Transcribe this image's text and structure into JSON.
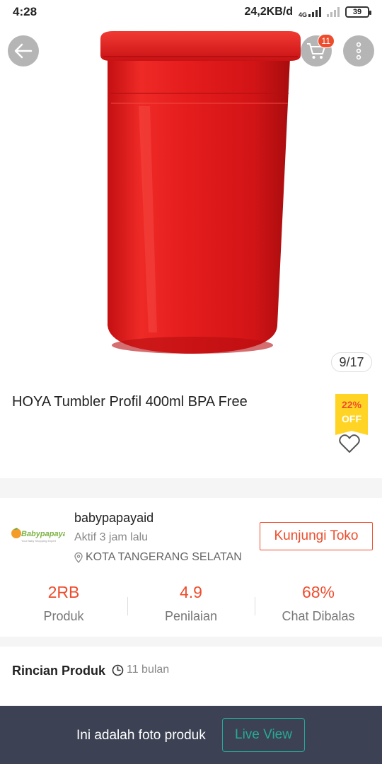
{
  "status_bar": {
    "time": "4:28",
    "network_speed": "24,2KB/d",
    "network_type": "4G",
    "battery": "39"
  },
  "header": {
    "cart_count": "11"
  },
  "gallery": {
    "counter": "9/17"
  },
  "product": {
    "title": "HOYA Tumbler Profil 400ml BPA Free",
    "discount_percent": "22%",
    "discount_off": "OFF"
  },
  "shop": {
    "name": "babypapayaid",
    "active_status": "Aktif 3 jam lalu",
    "location": "KOTA TANGERANG SELATAN",
    "visit_label": "Kunjungi Toko",
    "logo_text": "Babypapaya",
    "logo_tagline": "Your Baby Shopping Expert",
    "stats": [
      {
        "value": "2RB",
        "label": "Produk"
      },
      {
        "value": "4.9",
        "label": "Penilaian"
      },
      {
        "value": "68%",
        "label": "Chat Dibalas"
      }
    ]
  },
  "details": {
    "title": "Rincian Produk",
    "time": "11 bulan"
  },
  "bottom_bar": {
    "text": "Ini adalah foto produk",
    "live_label": "Live View"
  },
  "colors": {
    "accent": "#ee4d2d",
    "teal": "#26aa99",
    "badge_yellow": "#ffd424",
    "bottom_bar": "#3c4253",
    "tumbler_red": "#e01e1e"
  },
  "icons": [
    "back-arrow-icon",
    "cart-icon",
    "more-vertical-icon",
    "heart-icon",
    "location-pin-icon",
    "clock-icon"
  ]
}
